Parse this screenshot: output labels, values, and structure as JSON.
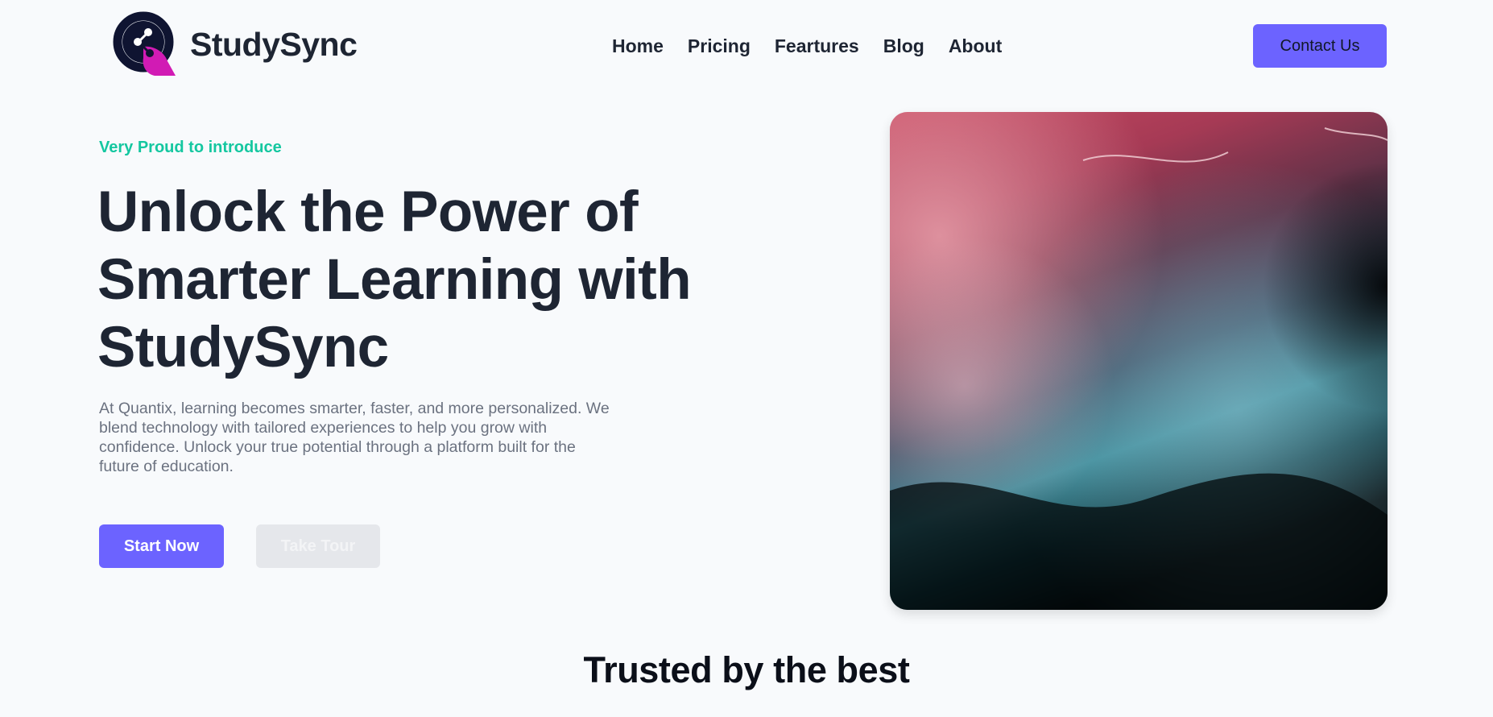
{
  "brand": {
    "name": "StudySync",
    "primary_color": "#6c63ff",
    "accent_color": "#14c7a0",
    "logo_icon": "share-node-logo-icon"
  },
  "nav": {
    "items": [
      {
        "label": "Home"
      },
      {
        "label": "Pricing"
      },
      {
        "label": "Feartures"
      },
      {
        "label": "Blog"
      },
      {
        "label": "About"
      }
    ],
    "contact_label": "Contact Us"
  },
  "hero": {
    "eyebrow": "Very Proud to introduce",
    "title": "Unlock the Power of Smarter Learning with StudySync",
    "description": "At Quantix, learning becomes smarter, faster, and more personalized. We blend technology with tailored experiences to help you grow with confidence. Unlock your true potential through a platform built for the future of education.",
    "primary_cta": "Start Now",
    "secondary_cta": "Take Tour",
    "image": "abstract-fluid-art-image"
  },
  "trusted": {
    "heading": "Trusted by the best"
  }
}
